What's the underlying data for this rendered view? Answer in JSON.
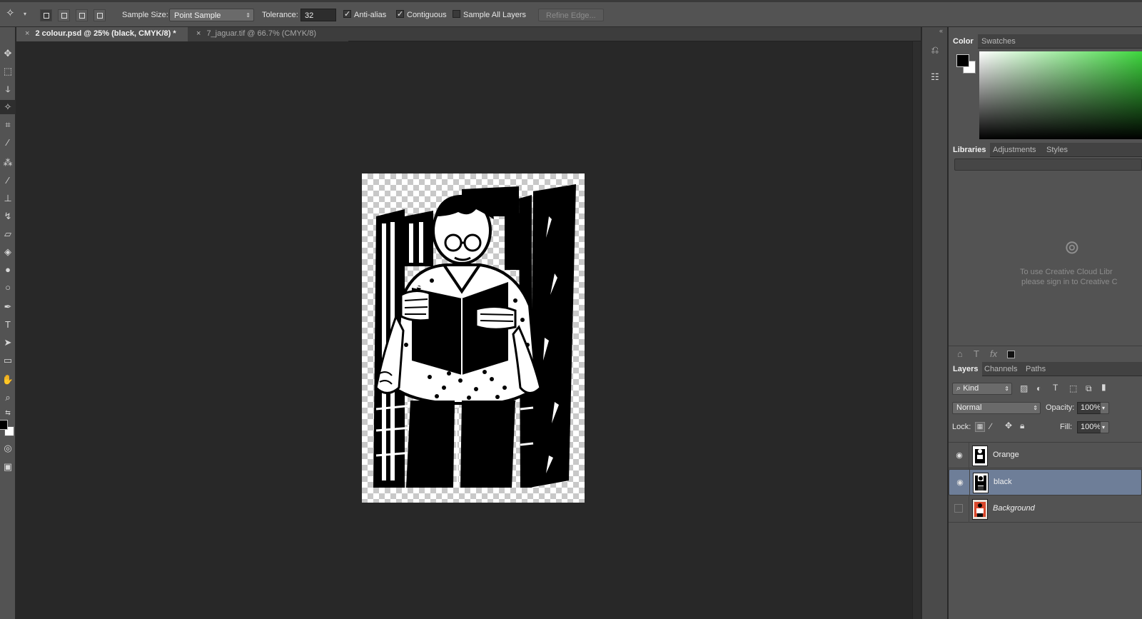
{
  "options_bar": {
    "sample_size_label": "Sample Size:",
    "sample_size_value": "Point Sample",
    "tolerance_label": "Tolerance:",
    "tolerance_value": "32",
    "anti_alias_label": "Anti-alias",
    "anti_alias_checked": true,
    "contiguous_label": "Contiguous",
    "contiguous_checked": true,
    "sample_all_layers_label": "Sample All Layers",
    "sample_all_layers_checked": false,
    "refine_edge_label": "Refine Edge..."
  },
  "doc_tabs": [
    {
      "label": "2 colour.psd @ 25% (black, CMYK/8) *",
      "active": true
    },
    {
      "label": "7_jaguar.tif @ 66.7% (CMYK/8)",
      "active": false
    }
  ],
  "color_panel": {
    "tabs": [
      "Color",
      "Swatches"
    ],
    "foreground": "#000000",
    "background": "#ffffff",
    "accent": "#3cd63c"
  },
  "libraries_panel": {
    "tabs": [
      "Libraries",
      "Adjustments",
      "Styles"
    ],
    "message_line1": "To use Creative Cloud Libr",
    "message_line2": "please sign in to Creative C"
  },
  "layers_panel": {
    "tabs": [
      "Layers",
      "Channels",
      "Paths"
    ],
    "filter_label": "Kind",
    "blend_mode": "Normal",
    "opacity_label": "Opacity:",
    "opacity_value": "100%",
    "lock_label": "Lock:",
    "fill_label": "Fill:",
    "fill_value": "100%",
    "layers": [
      {
        "name": "Orange",
        "visible": true,
        "selected": false
      },
      {
        "name": "black",
        "visible": true,
        "selected": true
      },
      {
        "name": "Background",
        "visible": false,
        "selected": false
      }
    ]
  }
}
